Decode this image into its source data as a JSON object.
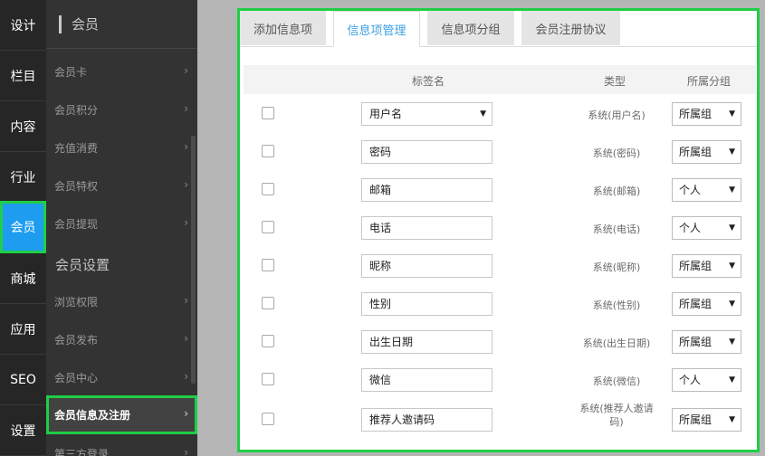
{
  "rail": {
    "items": [
      "设计",
      "栏目",
      "内容",
      "行业",
      "会员",
      "商城",
      "应用",
      "SEO",
      "设置"
    ]
  },
  "sidebar": {
    "title": "会员",
    "items_a": [
      "会员卡",
      "会员积分",
      "充值消费",
      "会员特权",
      "会员提现"
    ],
    "group_title": "会员设置",
    "items_b": [
      "浏览权限",
      "会员发布",
      "会员中心",
      "会员信息及注册",
      "第三方登录"
    ]
  },
  "tabs": [
    "添加信息项",
    "信息项管理",
    "信息项分组",
    "会员注册协议"
  ],
  "table": {
    "headers": {
      "label": "标签名",
      "type": "类型",
      "group": "所属分组"
    },
    "rows": [
      {
        "label": "用户名",
        "type": "系统(用户名)",
        "group": "所属组"
      },
      {
        "label": "密码",
        "type": "系统(密码)",
        "group": "所属组"
      },
      {
        "label": "邮箱",
        "type": "系统(邮箱)",
        "group": "个人"
      },
      {
        "label": "电话",
        "type": "系统(电话)",
        "group": "个人"
      },
      {
        "label": "昵称",
        "type": "系统(昵称)",
        "group": "所属组"
      },
      {
        "label": "性别",
        "type": "系统(性别)",
        "group": "所属组"
      },
      {
        "label": "出生日期",
        "type": "系统(出生日期)",
        "group": "所属组"
      },
      {
        "label": "微信",
        "type": "系统(微信)",
        "group": "个人"
      },
      {
        "label": "推荐人邀请码",
        "type": "系统(推荐人邀请码)",
        "group": "所属组"
      }
    ]
  },
  "icons": {
    "chevron": "chevron-right-icon",
    "caret": "caret-down-icon"
  },
  "colors": {
    "accent": "#1e9cf0",
    "highlight_border": "#1fce46",
    "tab_active": "#3f9fe0"
  }
}
